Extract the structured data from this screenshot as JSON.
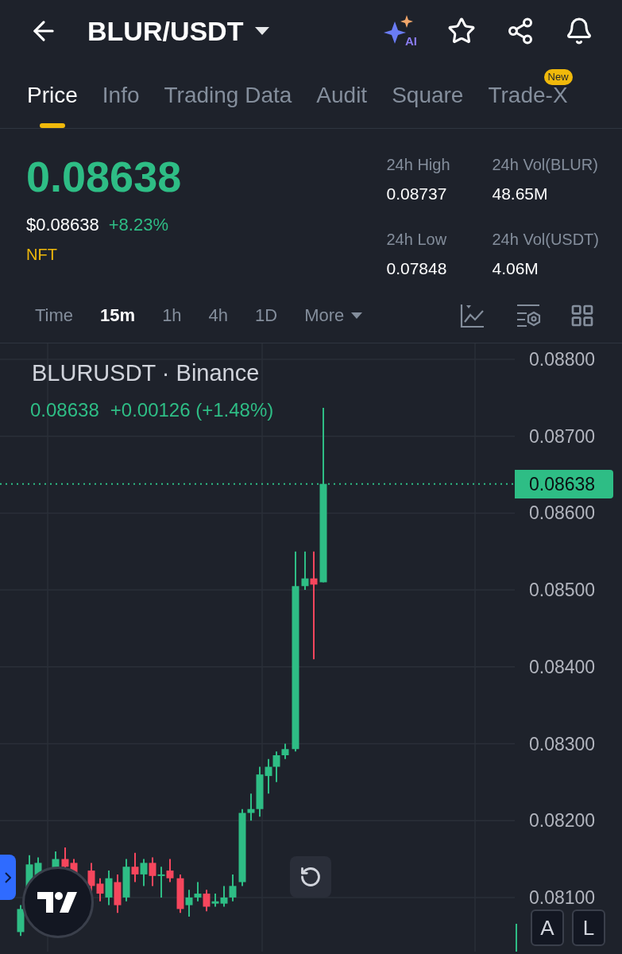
{
  "header": {
    "title": "BLUR/USDT",
    "ai_label": "AI"
  },
  "tabs": [
    {
      "label": "Price",
      "selected": true
    },
    {
      "label": "Info",
      "selected": false
    },
    {
      "label": "Trading Data",
      "selected": false
    },
    {
      "label": "Audit",
      "selected": false
    },
    {
      "label": "Square",
      "selected": false
    },
    {
      "label": "Trade-X",
      "selected": false,
      "badge": "New"
    }
  ],
  "ticker": {
    "price": "0.08638",
    "usd_price": "$0.08638",
    "change": "+8.23%",
    "tag": "NFT"
  },
  "stats": [
    {
      "label": "24h High",
      "value": "0.08737"
    },
    {
      "label": "24h Vol(BLUR)",
      "value": "48.65M"
    },
    {
      "label": "24h Low",
      "value": "0.07848"
    },
    {
      "label": "24h Vol(USDT)",
      "value": "4.06M"
    }
  ],
  "intervals": [
    {
      "label": "Time",
      "selected": false,
      "kind": "option"
    },
    {
      "label": "15m",
      "selected": true,
      "kind": "option"
    },
    {
      "label": "1h",
      "selected": false,
      "kind": "option"
    },
    {
      "label": "4h",
      "selected": false,
      "kind": "option"
    },
    {
      "label": "1D",
      "selected": false,
      "kind": "option"
    },
    {
      "label": "More",
      "selected": false,
      "kind": "dropdown"
    }
  ],
  "chart": {
    "symbol": "BLURUSDT · Binance",
    "last": "0.08638",
    "change": "+0.00126 (+1.48%)",
    "price_axis": [
      "0.08800",
      "0.08700",
      "0.08600",
      "0.08500",
      "0.08400",
      "0.08300",
      "0.08200",
      "0.08100"
    ],
    "last_price": "0.08638",
    "scale_buttons": [
      "A",
      "L"
    ]
  }
}
